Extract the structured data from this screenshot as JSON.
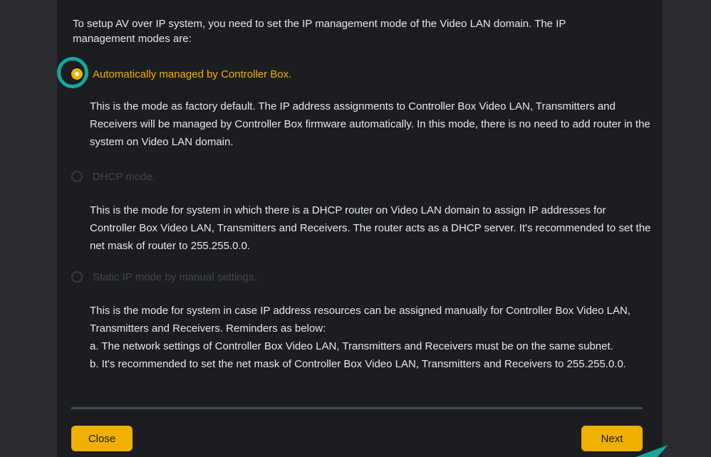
{
  "intro": {
    "text": "To setup AV over IP system, you need to set the IP management mode of the Video LAN domain. The IP management modes are:"
  },
  "options": [
    {
      "label": "Automatically managed by Controller Box.",
      "selected": true,
      "description": "This is the mode as factory default. The IP address assignments to Controller Box Video LAN, Transmitters and Receivers will be managed by Controller Box firmware automatically. In this mode, there is no need to add router in the system on Video LAN domain."
    },
    {
      "label": "DHCP mode.",
      "selected": false,
      "description": "This is the mode for system in which there is a DHCP router on Video LAN domain to assign IP addresses for Controller Box Video LAN, Transmitters and Receivers. The router acts as a DHCP server. It's recommended to set the net mask of router to 255.255.0.0."
    },
    {
      "label": "Static IP mode by manual settings.",
      "selected": false,
      "description_lines": [
        "This is the mode for system in case IP address resources can be assigned manually for Controller Box Video LAN, Transmitters and Receivers. Reminders as below:",
        "a. The network settings of Controller Box Video LAN, Transmitters and Receivers must be on the same subnet.",
        "b. It's recommended to set the net mask of Controller Box Video LAN, Transmitters and Receivers to 255.255.0.0."
      ]
    }
  ],
  "buttons": {
    "close_label": "Close",
    "next_label": "Next"
  },
  "colors": {
    "accent": "#f0b000",
    "highlight_ring": "#15a89a",
    "panel_bg": "#1b1d21",
    "disabled_text": "#45474c"
  }
}
